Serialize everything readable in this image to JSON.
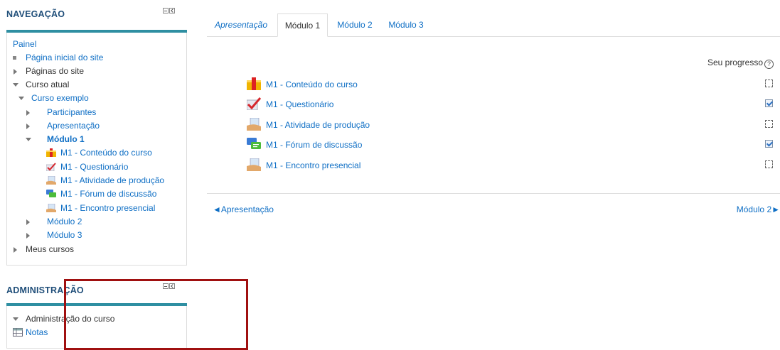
{
  "navigation": {
    "title": "NAVEGAÇÃO",
    "items": {
      "painel": "Painel",
      "home": "Página inicial do site",
      "site_pages": "Páginas do site",
      "current_course": "Curso atual",
      "example_course": "Curso exemplo",
      "participants": "Participantes",
      "presentation": "Apresentação",
      "module1": "Módulo 1",
      "m1_content": "M1 - Conteúdo do curso",
      "m1_quiz": "M1 - Questionário",
      "m1_production": "M1 - Atividade de produção",
      "m1_forum": "M1 - Fórum de discussão",
      "m1_meeting": "M1 - Encontro presencial",
      "module2": "Módulo 2",
      "module3": "Módulo 3",
      "my_courses": "Meus cursos"
    }
  },
  "administration": {
    "title": "ADMINISTRAÇÃO",
    "items": {
      "course_admin": "Administração do curso",
      "grades": "Notas"
    }
  },
  "tabs": {
    "presentation": "Apresentação",
    "module1": "Módulo 1",
    "module2": "Módulo 2",
    "module3": "Módulo 3"
  },
  "progress": {
    "label": "Seu progresso",
    "help_glyph": "?"
  },
  "activities": [
    {
      "name": "M1 - Conteúdo do curso",
      "icon": "package-icon",
      "completed": false
    },
    {
      "name": "M1 - Questionário",
      "icon": "quiz-icon",
      "completed": true
    },
    {
      "name": "M1 - Atividade de produção",
      "icon": "assignment-icon",
      "completed": false
    },
    {
      "name": "M1 - Fórum de discussão",
      "icon": "forum-icon",
      "completed": true
    },
    {
      "name": "M1 - Encontro presencial",
      "icon": "assignment-icon",
      "completed": false
    }
  ],
  "pagination": {
    "prev": "◄Apresentação",
    "next": "Módulo 2►"
  },
  "colors": {
    "link": "#0f6fc5",
    "block_bar": "#2f8fa2",
    "block_title": "#1f4e79",
    "highlight": "#a01010"
  }
}
